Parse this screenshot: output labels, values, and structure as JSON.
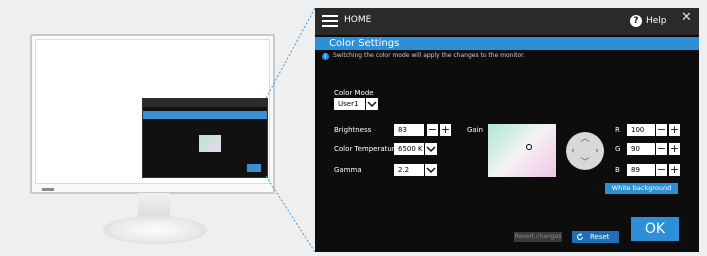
{
  "header": {
    "home_label": "HOME",
    "help_label": "Help",
    "close_glyph": "✕"
  },
  "section": {
    "title": "Color Settings",
    "info": "Switching the color mode will apply the changes to the monitor."
  },
  "color_mode": {
    "label": "Color Mode",
    "value": "User1"
  },
  "brightness": {
    "label": "Brightness",
    "value": "83"
  },
  "color_temperature": {
    "label": "Color Temperature",
    "value": "6500 K"
  },
  "gamma": {
    "label": "Gamma",
    "value": "2.2"
  },
  "gain": {
    "label": "Gain",
    "r": {
      "label": "R",
      "value": "100"
    },
    "g": {
      "label": "G",
      "value": "90"
    },
    "b": {
      "label": "B",
      "value": "89"
    }
  },
  "buttons": {
    "white_background": "White background",
    "revert_changes": "Revert changes",
    "reset": "Reset",
    "ok": "OK"
  },
  "colors": {
    "accent": "#2d8fd6",
    "panel_bg": "#0d0d0d",
    "titlebar_bg": "#2a2a2a"
  }
}
